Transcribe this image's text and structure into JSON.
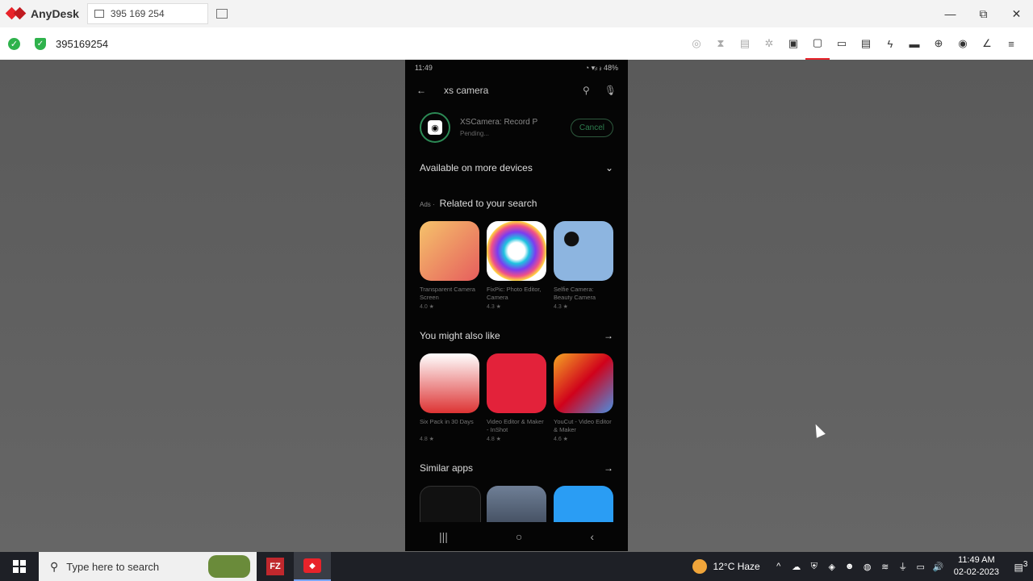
{
  "titlebar": {
    "app_name": "AnyDesk",
    "tab_address": "395 169 254"
  },
  "window_controls": {
    "minimize": "—",
    "restore": "⧉",
    "close": "✕"
  },
  "toolbar": {
    "session_id": "395169254"
  },
  "phone": {
    "status_time": "11:49",
    "status_right": "◔ ▾ᵢₗ ᵢₗ 48%",
    "search_query": "xs camera",
    "pending_app": {
      "name": "XSCamera: Record P",
      "status": "Pending...",
      "cancel_label": "Cancel"
    },
    "section_devices": "Available on more devices",
    "section_related": {
      "ads": "Ads ·",
      "label": "Related to your search"
    },
    "related_apps": [
      {
        "name": "Transparent Camera Screen",
        "rating": "4.0 ★"
      },
      {
        "name": "FixPic: Photo Editor, Camera",
        "rating": "4.3 ★"
      },
      {
        "name": "Selfie Camera: Beauty Camera",
        "rating": "4.3 ★"
      }
    ],
    "section_also_like": "You might also like",
    "also_like_apps": [
      {
        "name": "Six Pack in 30 Days",
        "rating": "4.8 ★"
      },
      {
        "name": "Video Editor & Maker - InShot",
        "rating": "4.8 ★"
      },
      {
        "name": "YouCut - Video Editor & Maker",
        "rating": "4.6 ★"
      }
    ],
    "section_similar": "Similar apps"
  },
  "taskbar": {
    "search_placeholder": "Type here to search",
    "filezilla_label": "FZ",
    "weather": "12°C  Haze",
    "time": "11:49 AM",
    "date": "02-02-2023",
    "notifications": "3"
  },
  "colors": {
    "anydesk_red": "#e8232a",
    "ok_green": "#2fb24c",
    "play_green": "#2e7d4e"
  }
}
